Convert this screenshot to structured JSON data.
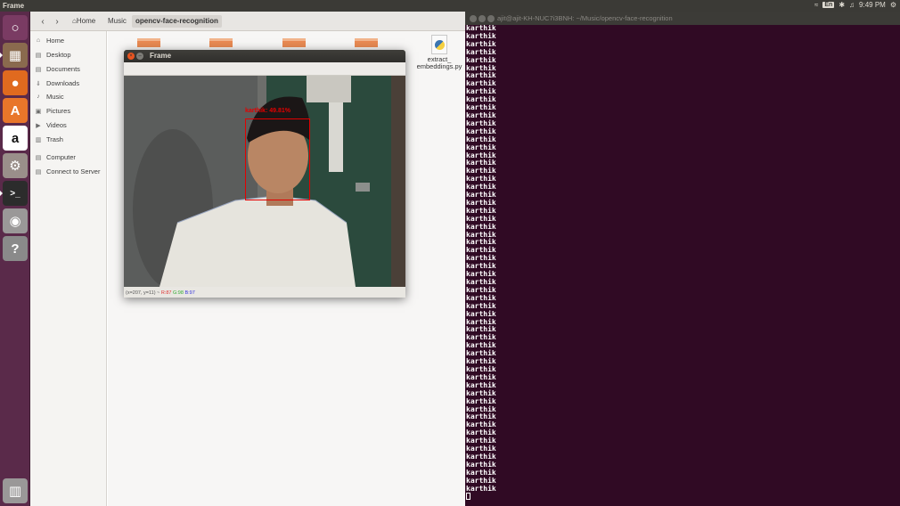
{
  "top_panel": {
    "window_title": "Frame",
    "keyboard": "En",
    "clock": "9:49 PM"
  },
  "launcher": {
    "items": [
      {
        "name": "ubuntu-dash-icon",
        "color": "#7a3b63"
      },
      {
        "name": "files-icon",
        "color": "#8a6a4e"
      },
      {
        "name": "firefox-icon",
        "color": "#e06a1f"
      },
      {
        "name": "software-center-icon",
        "color": "#e8762a"
      },
      {
        "name": "amazon-icon",
        "color": "#ffffff"
      },
      {
        "name": "system-settings-icon",
        "color": "#9a8f8a"
      },
      {
        "name": "terminal-icon",
        "color": "#2c2c2c"
      },
      {
        "name": "camera-icon",
        "color": "#9a9898"
      },
      {
        "name": "help-icon",
        "color": "#8a8a8a"
      },
      {
        "name": "trash-icon",
        "color": "#9a9898"
      }
    ]
  },
  "files": {
    "breadcrumbs": [
      "Home",
      "Music",
      "opencv-face-recognition"
    ],
    "sidebar": [
      "Home",
      "Desktop",
      "Documents",
      "Downloads",
      "Music",
      "Pictures",
      "Videos",
      "Trash",
      "Computer",
      "Connect to Server"
    ],
    "file_label": "extract_ embeddings.py"
  },
  "frame": {
    "title": "Frame",
    "detection_label": "karthik: 49.81%",
    "status": {
      "coords": "(x=207, y=11) ~",
      "r": "R:87",
      "g": "G:98",
      "b": "B:97"
    }
  },
  "terminal": {
    "title": "ajit@ajit-KH-NUC7i3BNH: ~/Music/opencv-face-recognition",
    "line_text": "karthik",
    "line_count": 59
  }
}
